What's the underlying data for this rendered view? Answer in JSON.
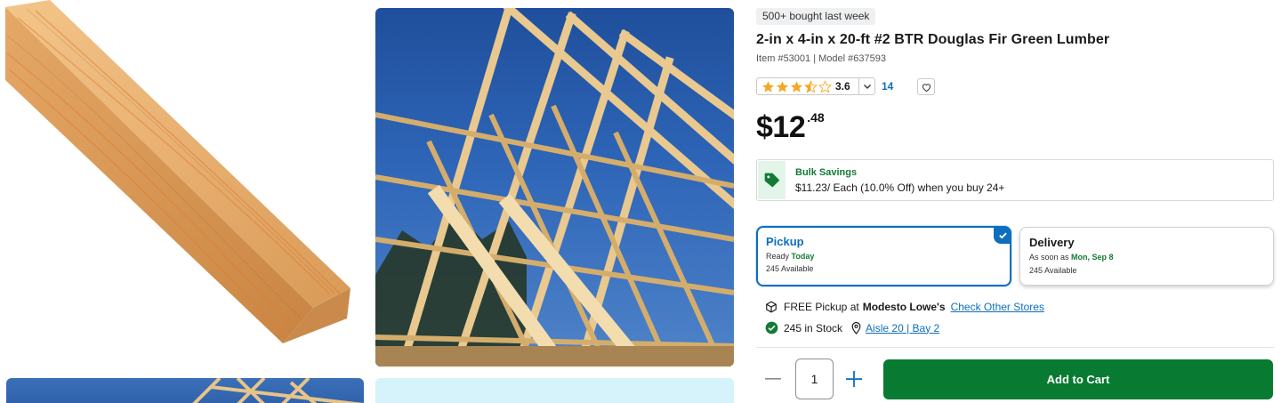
{
  "gallery": {
    "images": [
      {
        "icon": "lumber-board-image"
      },
      {
        "icon": "roof-truss-image"
      },
      {
        "icon": "roof-truss-thumbnail"
      },
      {
        "icon": "product-thumbnail"
      }
    ]
  },
  "product": {
    "social_proof": "500+ bought last week",
    "title": "2-in x 4-in x 20-ft #2 BTR Douglas Fir Green Lumber",
    "item_line": "Item #53001 | Model #637593",
    "rating": {
      "value": "3.6",
      "stars_fraction": 0.72,
      "count": "14"
    },
    "price": {
      "dollars": "$12",
      "cents": ".48"
    }
  },
  "bulk": {
    "title": "Bulk Savings",
    "description": "$11.23/ Each (10.0% Off) when you buy 24+",
    "accent": "#137a36"
  },
  "fulfillment": {
    "pickup": {
      "title": "Pickup",
      "ready_prefix": "Ready ",
      "ready_value": "Today",
      "available": "245 Available",
      "selected": true
    },
    "delivery": {
      "title": "Delivery",
      "date_prefix": "As soon as ",
      "date_value": "Mon, Sep 8",
      "available": "245 Available"
    }
  },
  "store": {
    "pickup_prefix": "FREE Pickup at",
    "store_name": "Modesto Lowe's",
    "check_other_link": "Check Other Stores",
    "stock_text": "245 in Stock",
    "aisle_link": "Aisle 20 | Bay 2"
  },
  "cart": {
    "quantity": "1",
    "add_label": "Add to Cart",
    "button_color": "#097a31"
  },
  "colors": {
    "link": "#0e6fbf",
    "success": "#137a36",
    "star": "#f5a623"
  }
}
